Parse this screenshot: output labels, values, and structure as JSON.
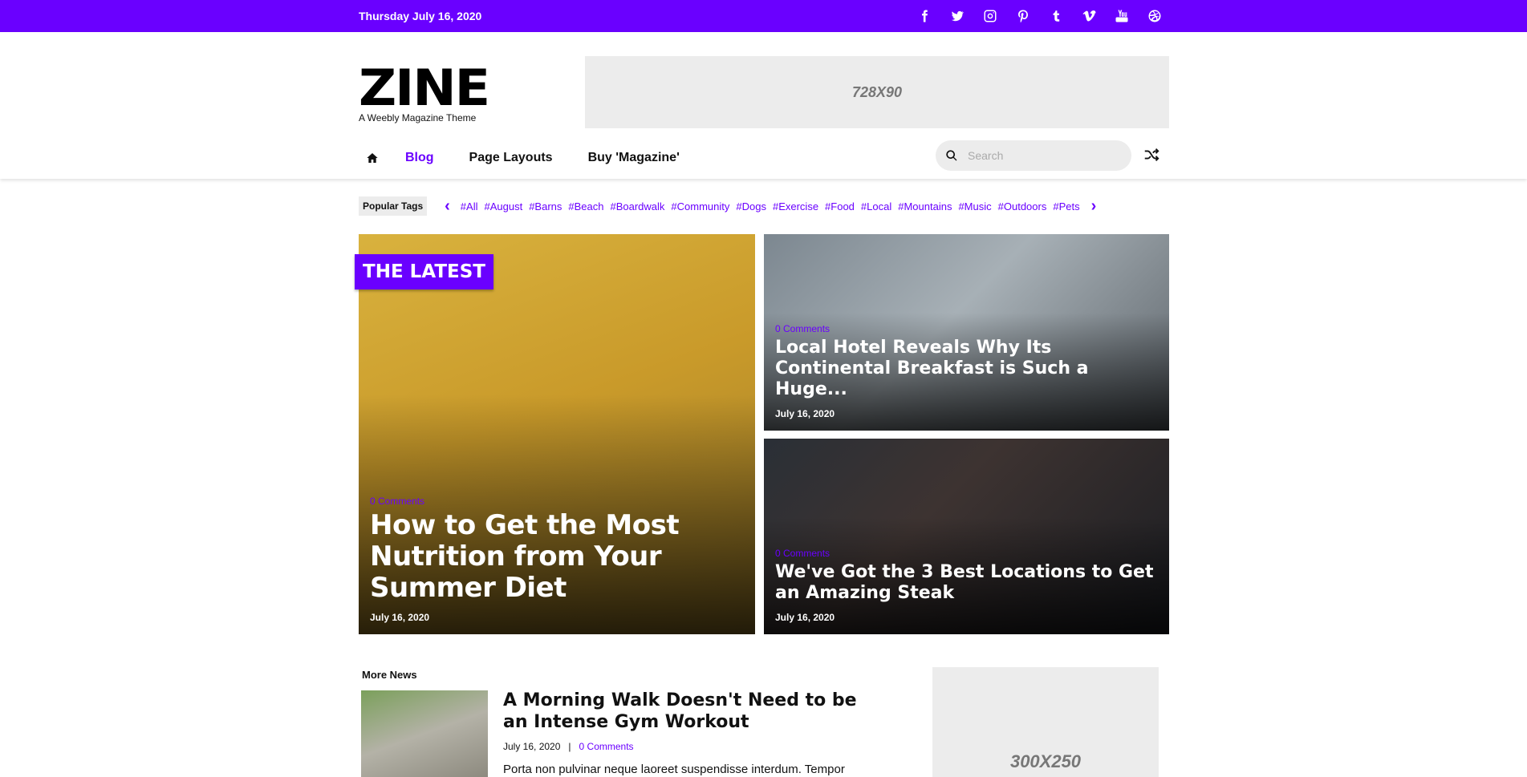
{
  "topbar": {
    "date": "Thursday July 16, 2020",
    "social": [
      "facebook-icon",
      "twitter-icon",
      "instagram-icon",
      "pinterest-icon",
      "tumblr-icon",
      "vimeo-icon",
      "youtube-icon",
      "dribbble-icon"
    ]
  },
  "brand": {
    "name": "ZINE",
    "tagline": "A Weebly Magazine Theme"
  },
  "ads": {
    "leaderboard": "728X90",
    "sidebar": "300X250"
  },
  "nav": {
    "items": [
      "Blog",
      "Page Layouts",
      "Buy 'Magazine'"
    ],
    "active": "Blog"
  },
  "search": {
    "placeholder": "Search"
  },
  "tags": {
    "label": "Popular Tags",
    "items": [
      "#All",
      "#August",
      "#Barns",
      "#Beach",
      "#Boardwalk",
      "#Community",
      "#Dogs",
      "#Exercise",
      "#Food",
      "#Local",
      "#Mountains",
      "#Music",
      "#Outdoors",
      "#Pets"
    ]
  },
  "featured": {
    "badge": "THE LATEST",
    "main": {
      "comments": "0 Comments",
      "title": "How to Get the Most Nutrition from Your Summer Diet",
      "date": "July 16, 2020"
    },
    "side1": {
      "comments": "0 Comments",
      "title": "Local Hotel Reveals Why Its Continental Breakfast is Such a Huge...",
      "date": "July 16, 2020"
    },
    "side2": {
      "comments": "0 Comments",
      "title": "We've Got the 3 Best Locations to Get an Amazing Steak",
      "date": "July 16, 2020"
    }
  },
  "more_news": {
    "heading": "More News",
    "article": {
      "title": "A Morning Walk Doesn't Need to be an Intense Gym Workout",
      "date": "July 16, 2020",
      "separator": "|",
      "comments": "0 Comments",
      "excerpt": "Porta non pulvinar neque laoreet suspendisse interdum. Tempor"
    }
  },
  "colors": {
    "accent": "#6a00ff",
    "ad_bg": "#ececec"
  }
}
